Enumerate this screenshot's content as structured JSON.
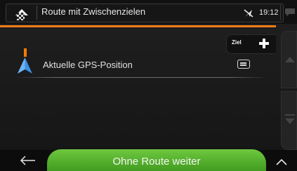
{
  "header": {
    "title": "Route mit Zwischenzielen",
    "time": "19:12"
  },
  "destination": {
    "ziel_label": "Ziel"
  },
  "route_points": [
    {
      "label": "Aktuelle GPS-Position"
    }
  ],
  "footer": {
    "primary_label": "Ohne Route weiter"
  },
  "colors": {
    "accent": "#f07d1a",
    "primary_button": "#55b22c",
    "background": "#1b1b1b"
  }
}
